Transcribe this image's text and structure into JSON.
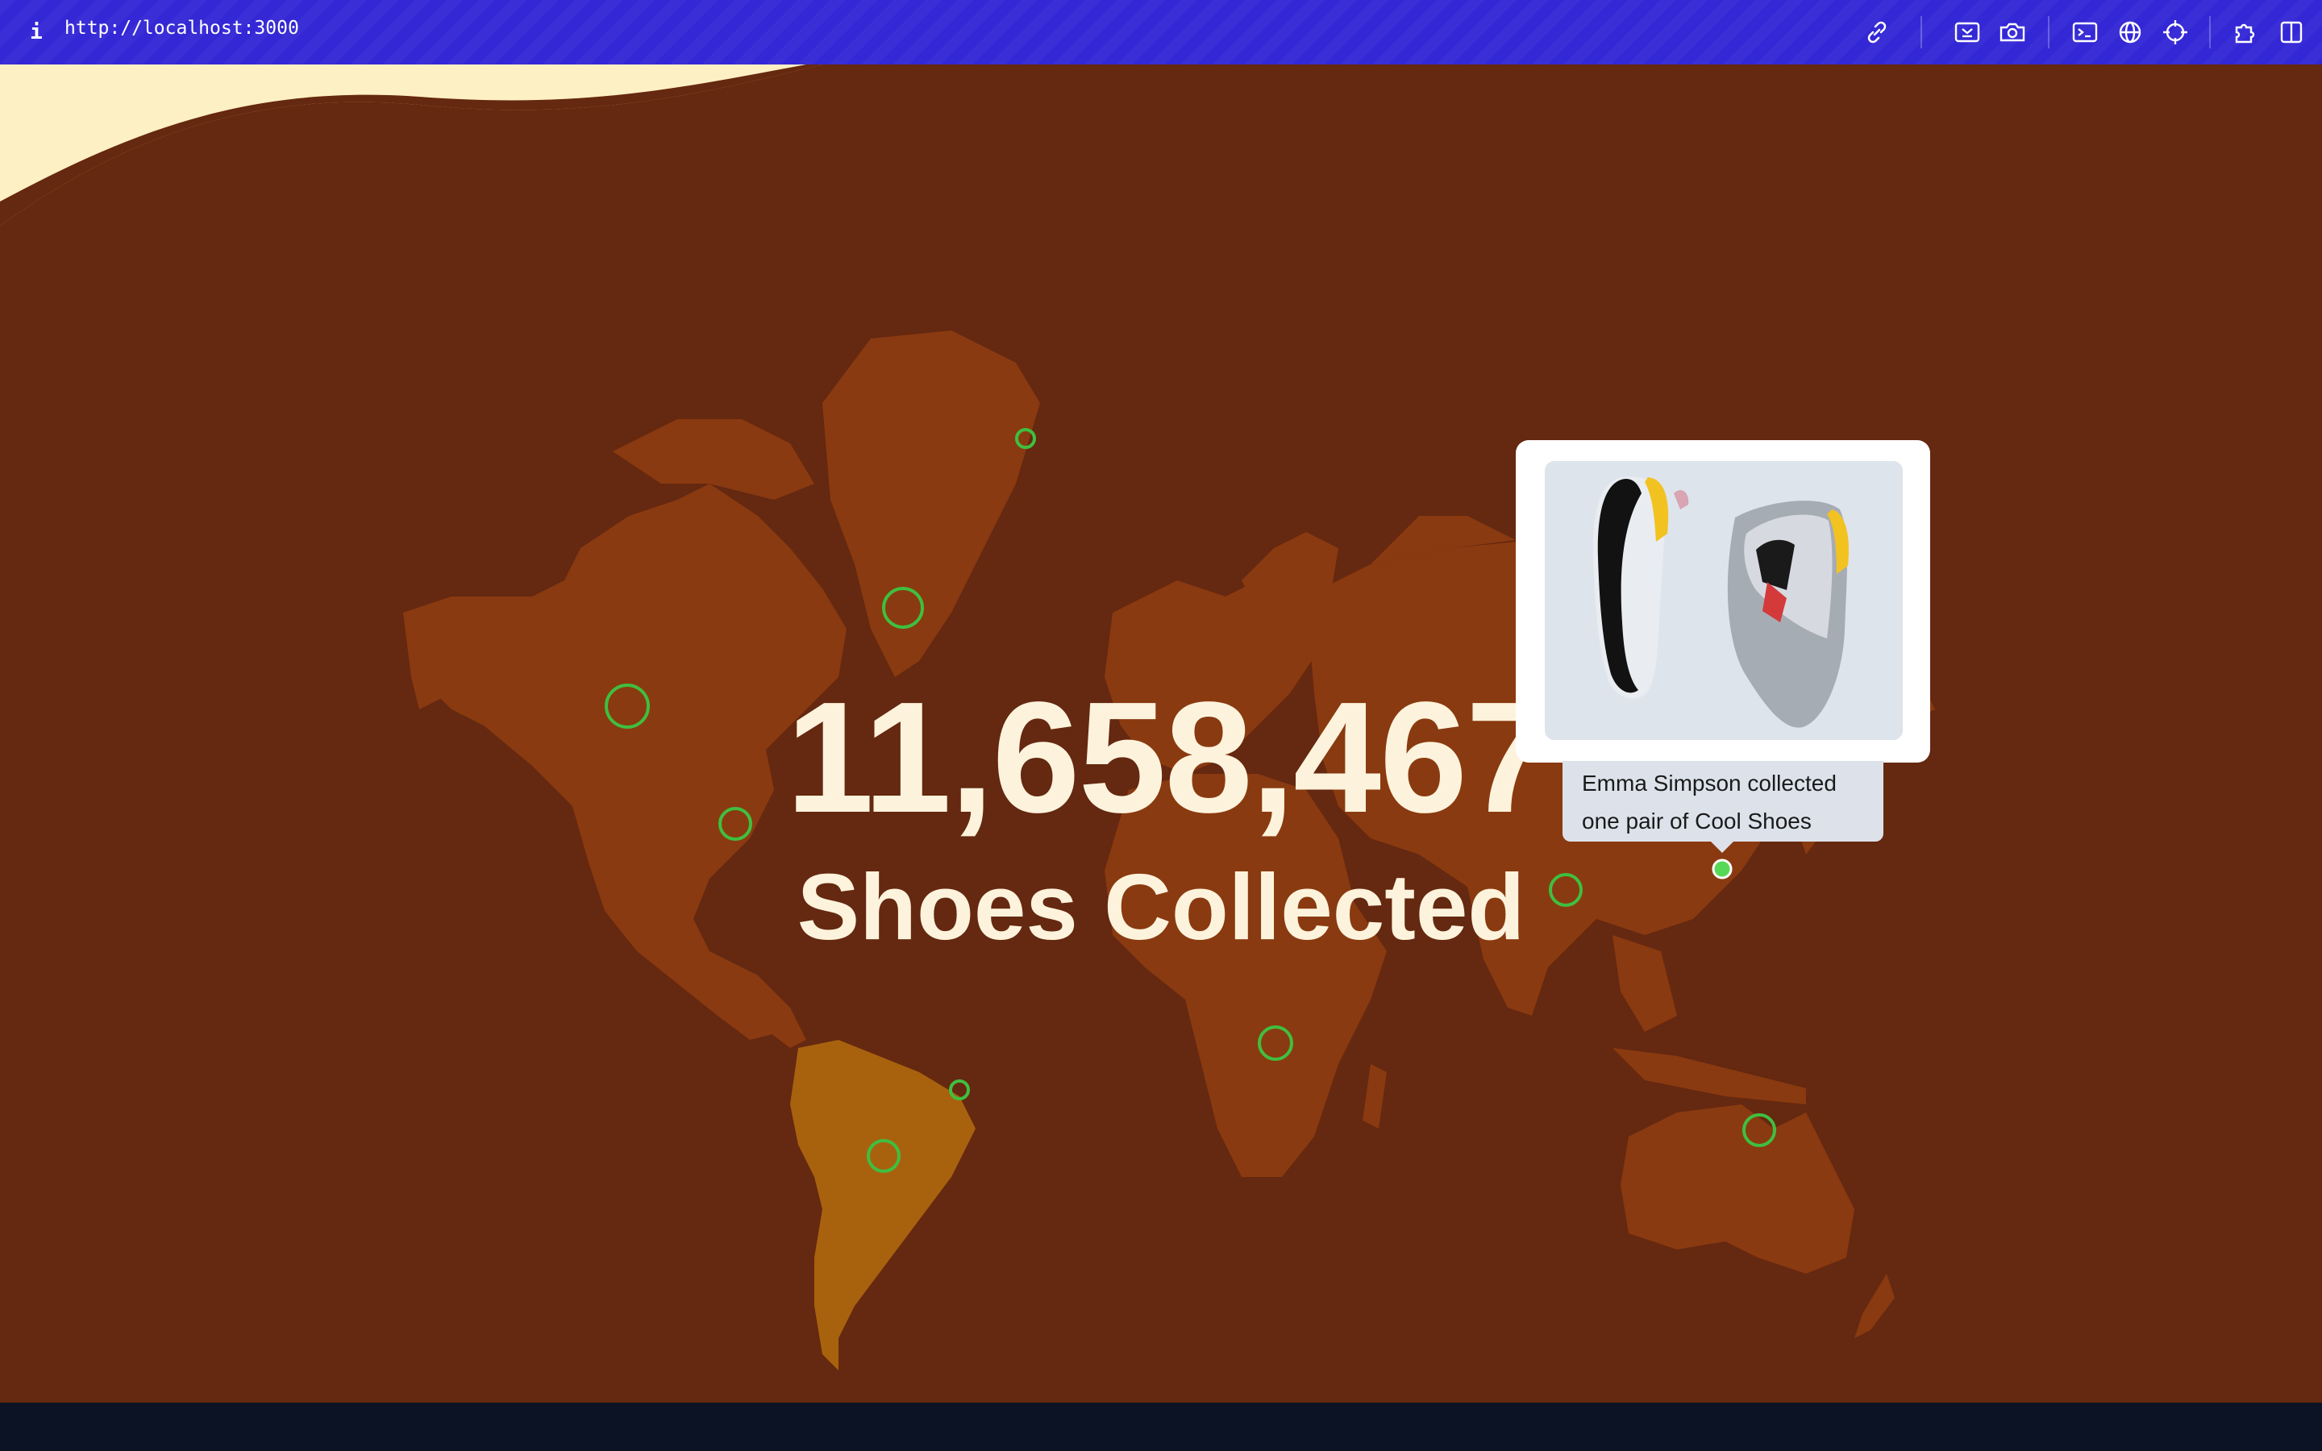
{
  "browser": {
    "url": "http://localhost:3000",
    "info_icon": "i",
    "toolbar_icons": [
      "link-icon",
      "inspect-icon",
      "camera-icon",
      "terminal-icon",
      "globe-icon",
      "crosshair-icon",
      "extensions-icon",
      "sidebar-icon"
    ],
    "accent": "#3327d6"
  },
  "counter": {
    "value": "11,658,467",
    "label": "Shoes Collected"
  },
  "popup": {
    "message": "Emma Simpson collected one pair of Cool Shoes",
    "image": "sneaker-pair-illustration"
  },
  "colors": {
    "background": "#652810",
    "land": "#8a3a10",
    "south_america": "#a8620e",
    "marker": "#3fbf3f",
    "text": "#fdf3dc",
    "cream_wave": "#fbeab0"
  }
}
